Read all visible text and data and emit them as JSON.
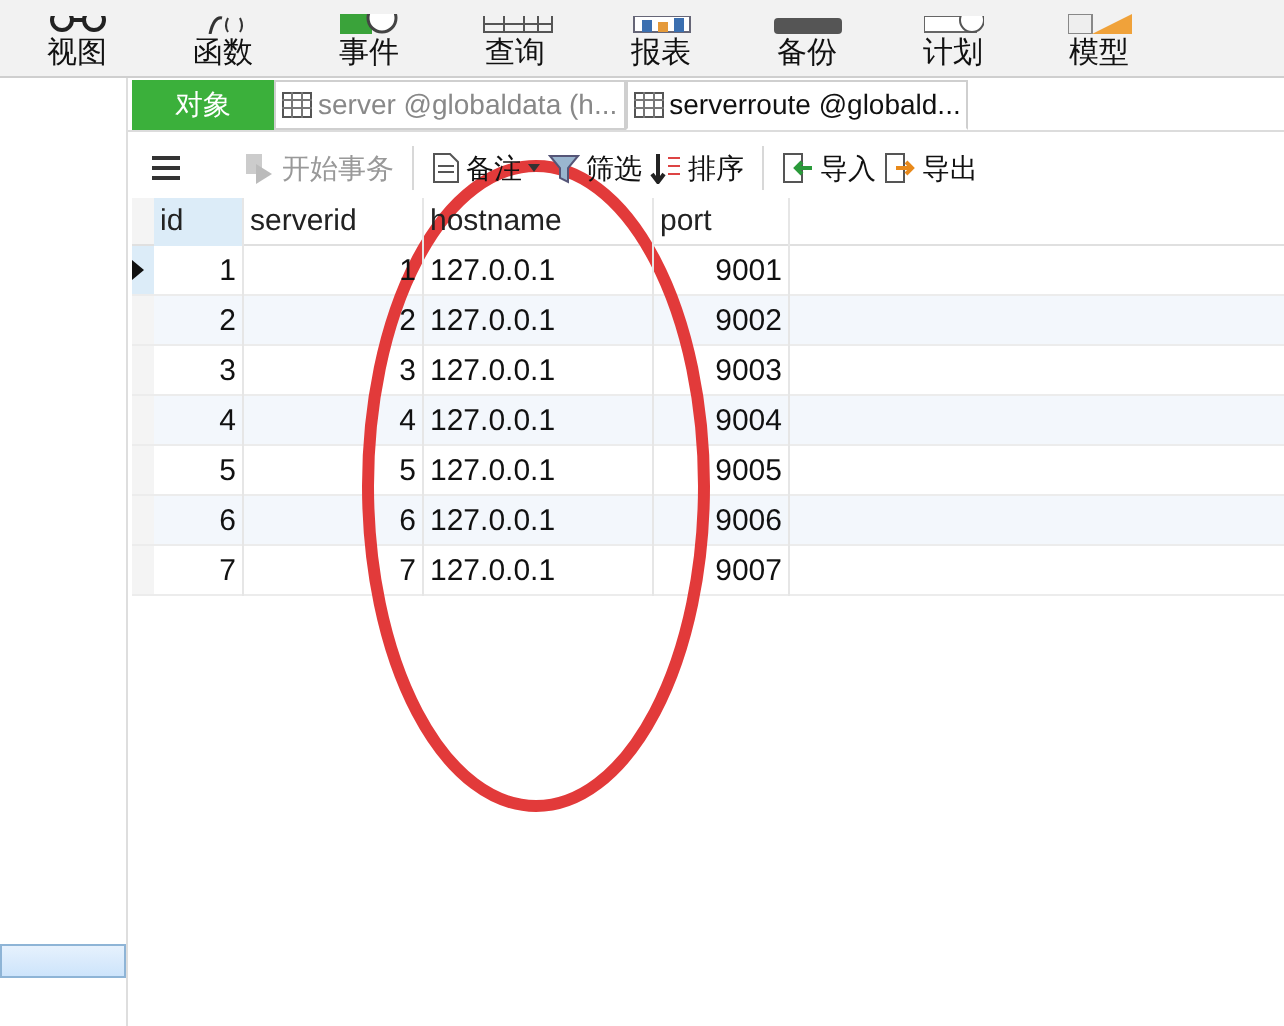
{
  "main_toolbar": [
    {
      "label": "视图"
    },
    {
      "label": "函数"
    },
    {
      "label": "事件"
    },
    {
      "label": "查询"
    },
    {
      "label": "报表"
    },
    {
      "label": "备份"
    },
    {
      "label": "计划"
    },
    {
      "label": "模型"
    }
  ],
  "tabs": [
    {
      "label": "对象",
      "kind": "objects",
      "selected": false
    },
    {
      "label": "server @globaldata (h...",
      "kind": "table",
      "selected": false
    },
    {
      "label": "serverroute @globald...",
      "kind": "table",
      "selected": true
    }
  ],
  "table_toolbar": [
    {
      "kind": "menu"
    },
    {
      "kind": "button",
      "label": "开始事务",
      "disabled": true
    },
    {
      "kind": "divider"
    },
    {
      "kind": "button",
      "label": "备注",
      "dropdown": true,
      "disabled": false
    },
    {
      "kind": "button",
      "label": "筛选",
      "disabled": false
    },
    {
      "kind": "button",
      "label": "排序",
      "disabled": false
    },
    {
      "kind": "divider"
    },
    {
      "kind": "button",
      "label": "导入",
      "disabled": false
    },
    {
      "kind": "button",
      "label": "导出",
      "disabled": false
    }
  ],
  "table": {
    "columns": [
      "id",
      "serverid",
      "hostname",
      "port"
    ],
    "rows": [
      {
        "cells": [
          "1",
          "1",
          "127.0.0.1",
          "9001"
        ],
        "selected": true
      },
      {
        "cells": [
          "2",
          "2",
          "127.0.0.1",
          "9002"
        ],
        "selected": false
      },
      {
        "cells": [
          "3",
          "3",
          "127.0.0.1",
          "9003"
        ],
        "selected": false
      },
      {
        "cells": [
          "4",
          "4",
          "127.0.0.1",
          "9004"
        ],
        "selected": false
      },
      {
        "cells": [
          "5",
          "5",
          "127.0.0.1",
          "9005"
        ],
        "selected": false
      },
      {
        "cells": [
          "6",
          "6",
          "127.0.0.1",
          "9006"
        ],
        "selected": false
      },
      {
        "cells": [
          "7",
          "7",
          "127.0.0.1",
          "9007"
        ],
        "selected": false
      }
    ]
  },
  "annotation": {
    "kind": "ellipse",
    "color": "#e23a3a"
  }
}
